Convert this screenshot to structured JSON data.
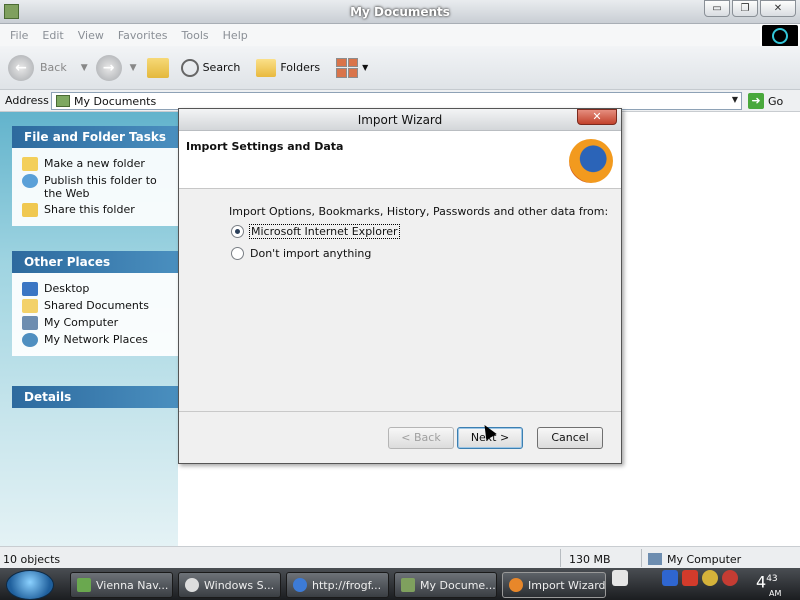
{
  "window": {
    "title": "My Documents"
  },
  "title_buttons": {
    "minimize": "▭",
    "maximize": "❐",
    "close": "✕"
  },
  "menu": [
    "File",
    "Edit",
    "View",
    "Favorites",
    "Tools",
    "Help"
  ],
  "toolbar": {
    "back": "Back",
    "search": "Search",
    "folders": "Folders"
  },
  "address": {
    "label": "Address",
    "value": "My Documents",
    "go": "Go"
  },
  "tasks": {
    "file_folder": {
      "title": "File and Folder Tasks",
      "items": [
        "Make a new folder",
        "Publish this folder to the Web",
        "Share this folder"
      ]
    },
    "other_places": {
      "title": "Other Places",
      "items": [
        "Desktop",
        "Shared Documents",
        "My Computer",
        "My Network Places"
      ]
    },
    "details": {
      "title": "Details"
    }
  },
  "status": {
    "objects": "10 objects",
    "size": "130 MB",
    "location": "My Computer"
  },
  "taskbar": {
    "items": [
      "Vienna Nav...",
      "Windows S...",
      "http://frogf...",
      "My Docume...",
      "Import Wizard"
    ],
    "active": "Import Wizard",
    "clock_hour": "4",
    "clock_min": "43",
    "clock_ampm": "AM"
  },
  "dialog": {
    "title": "Import Wizard",
    "close": "✕",
    "header": "Import Settings and Data",
    "prompt": "Import Options, Bookmarks, History, Passwords and other data from:",
    "options": [
      {
        "label": "Microsoft Internet Explorer",
        "selected": true
      },
      {
        "label": "Don't import anything",
        "selected": false
      }
    ],
    "buttons": {
      "back": "< Back",
      "next": "Next >",
      "cancel": "Cancel"
    }
  },
  "colors": {
    "task_header": "#2d6a9e",
    "pane_gradient_top": "#62b3cc",
    "dialog_bg": "#f0f0f0"
  }
}
